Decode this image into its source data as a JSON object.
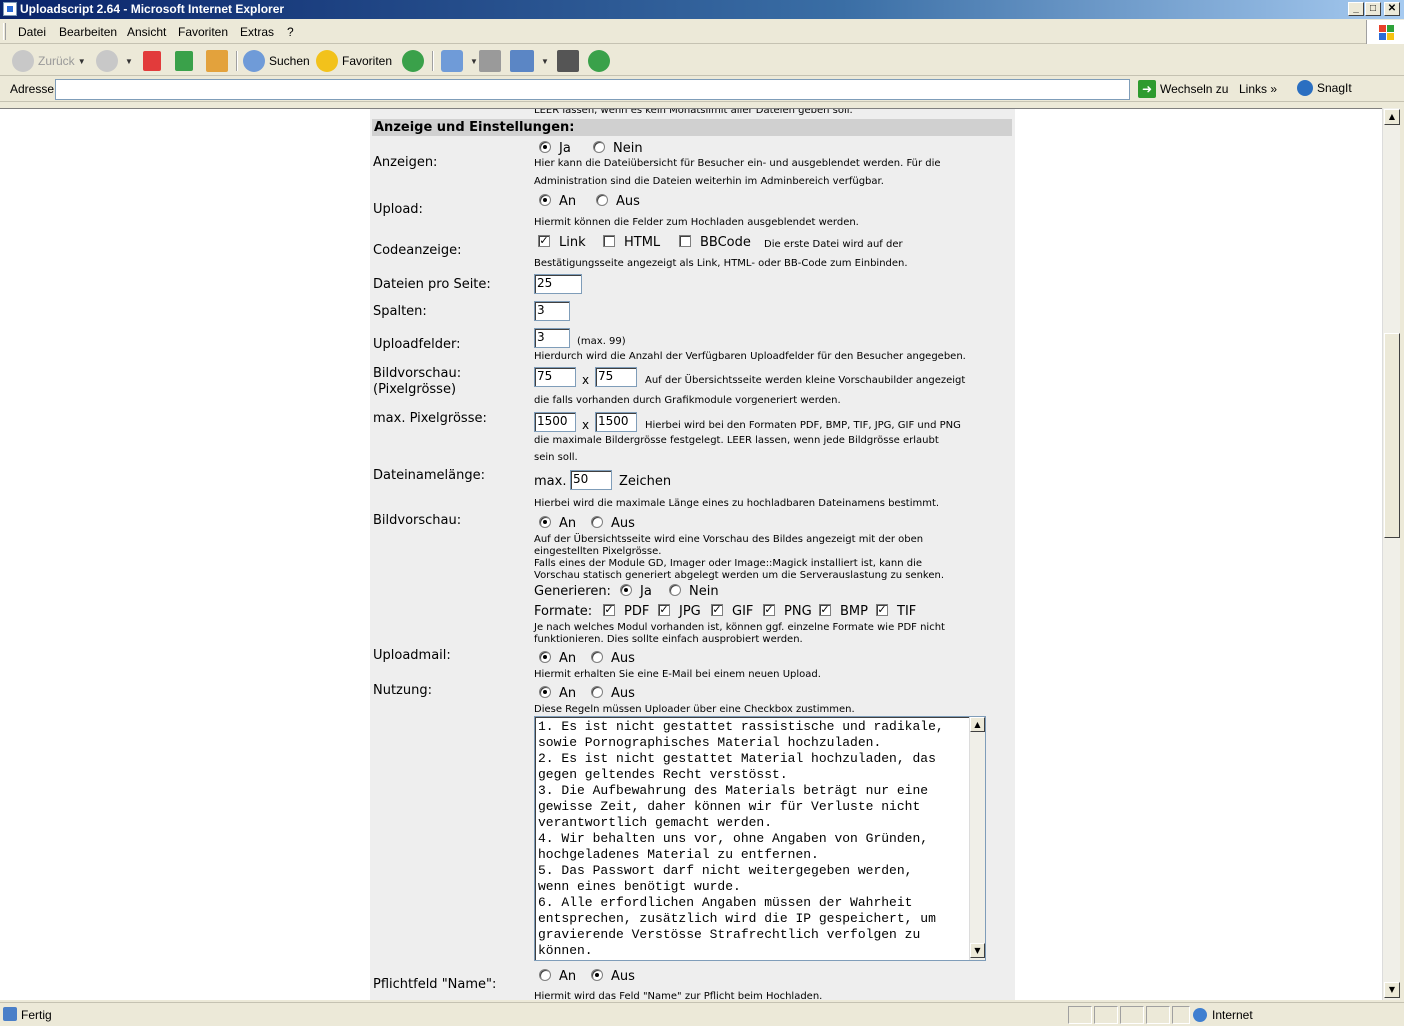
{
  "window": {
    "title": "Uploadscript 2.64 - Microsoft Internet Explorer",
    "controls": [
      "_",
      "□",
      "✕"
    ]
  },
  "menu": [
    "Datei",
    "Bearbeiten",
    "Ansicht",
    "Favoriten",
    "Extras",
    "?"
  ],
  "toolbar": {
    "back": "Zurück",
    "search": "Suchen",
    "favorites": "Favoriten"
  },
  "address": {
    "label": "Adresse",
    "value": "",
    "go": "Wechseln zu",
    "links": "Links",
    "snagit": "SnagIt"
  },
  "page": {
    "cutoff_text": "LEER lassen, wenn es kein Monatslimit aller Dateien geben soll.",
    "section_title": "Anzeige und Einstellungen:",
    "anzeigen": {
      "label": "Anzeigen:",
      "opt_yes": "Ja",
      "opt_no": "Nein",
      "desc1": "Hier kann die Dateiübersicht für Besucher ein- und ausgeblendet werden. Für die",
      "desc2": "Administration sind die Dateien weiterhin im Adminbereich verfügbar."
    },
    "upload": {
      "label": "Upload:",
      "opt_on": "An",
      "opt_off": "Aus",
      "desc": "Hiermit können die Felder zum Hochladen ausgeblendet werden."
    },
    "codeanzeige": {
      "label": "Codeanzeige:",
      "opt_link": "Link",
      "opt_html": "HTML",
      "opt_bbcode": "BBCode",
      "desc1": "Die erste Datei wird auf der",
      "desc2": "Bestätigungsseite angezeigt als Link, HTML- oder BB-Code zum Einbinden."
    },
    "dateien_pro_seite": {
      "label": "Dateien pro Seite:",
      "value": "25"
    },
    "spalten": {
      "label": "Spalten:",
      "value": "3"
    },
    "uploadfelder": {
      "label": "Uploadfelder:",
      "value": "3",
      "hint": "(max. 99)",
      "desc": "Hierdurch wird die Anzahl der Verfügbaren Uploadfelder für den Besucher angegeben."
    },
    "bildvorschau_size": {
      "label1": "Bildvorschau:",
      "label2": "(Pixelgrösse)",
      "width": "75",
      "height": "75",
      "x": "x",
      "desc1": "Auf der Übersichtsseite werden kleine Vorschaubilder angezeigt",
      "desc2": "die falls vorhanden durch Grafikmodule vorgeneriert werden."
    },
    "max_pixel": {
      "label": "max. Pixelgrösse:",
      "width": "1500",
      "height": "1500",
      "x": "x",
      "desc1": "Hierbei wird bei den Formaten PDF, BMP, TIF, JPG, GIF und PNG",
      "desc2": "die maximale Bildergrösse festgelegt. LEER lassen, wenn jede Bildgrösse erlaubt",
      "desc3": "sein soll."
    },
    "dateinamelaenge": {
      "label": "Dateinamelänge:",
      "prefix": "max.",
      "value": "50",
      "suffix": "Zeichen",
      "desc": "Hierbei wird die maximale Länge eines zu hochladbaren Dateinamens bestimmt."
    },
    "bildvorschau": {
      "label": "Bildvorschau:",
      "opt_on": "An",
      "opt_off": "Aus",
      "desc1": "Auf der Übersichtsseite wird eine Vorschau des Bildes angezeigt mit der oben",
      "desc2": "eingestellten Pixelgrösse.",
      "desc3": "Falls eines der Module GD, Imager oder Image::Magick installiert ist, kann die",
      "desc4": "Vorschau statisch generiert abgelegt werden um die Serverauslastung zu senken.",
      "gen_label": "Generieren:",
      "gen_yes": "Ja",
      "gen_no": "Nein",
      "formats_label": "Formate:",
      "formats": [
        "PDF",
        "JPG",
        "GIF",
        "PNG",
        "BMP",
        "TIF"
      ],
      "fdesc1": "Je nach welches Modul vorhanden ist, können ggf. einzelne Formate wie PDF nicht",
      "fdesc2": "funktionieren. Dies sollte einfach ausprobiert werden."
    },
    "uploadmail": {
      "label": "Uploadmail:",
      "opt_on": "An",
      "opt_off": "Aus",
      "desc": "Hiermit erhalten Sie eine E-Mail bei einem neuen Upload."
    },
    "nutzung": {
      "label": "Nutzung:",
      "opt_on": "An",
      "opt_off": "Aus",
      "desc": "Diese Regeln müssen Uploader über eine Checkbox zustimmen.",
      "text": "1. Es ist nicht gestattet rassistische und radikale,\nsowie Pornographisches Material hochzuladen.\n2. Es ist nicht gestattet Material hochzuladen, das\ngegen geltendes Recht verstösst.\n3. Die Aufbewahrung des Materials beträgt nur eine\ngewisse Zeit, daher können wir für Verluste nicht\nverantwortlich gemacht werden.\n4. Wir behalten uns vor, ohne Angaben von Gründen,\nhochgeladenes Material zu entfernen.\n5. Das Passwort darf nicht weitergegeben werden,\nwenn eines benötigt wurde.\n6. Alle erfordlichen Angaben müssen der Wahrheit\nentsprechen, zusätzlich wird die IP gespeichert, um\ngravierende Verstösse Strafrechtlich verfolgen zu\nkönnen."
    },
    "pflichtfeld_name": {
      "label": "Pflichtfeld \"Name\":",
      "opt_on": "An",
      "opt_off": "Aus",
      "desc": "Hiermit wird das Feld \"Name\" zur Pflicht beim Hochladen."
    }
  },
  "status": {
    "text": "Fertig",
    "zone": "Internet"
  }
}
